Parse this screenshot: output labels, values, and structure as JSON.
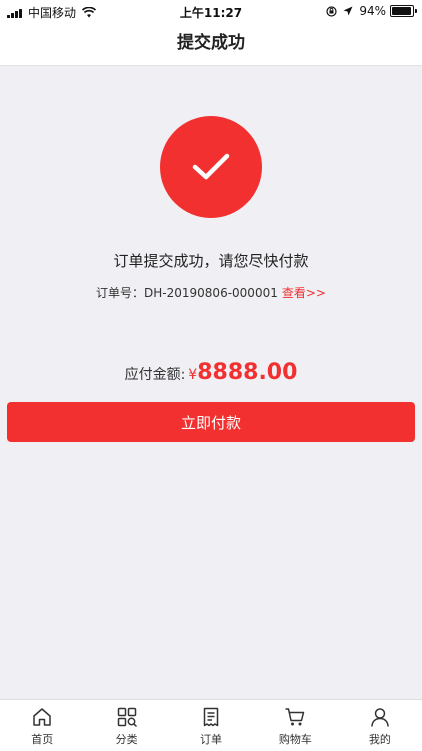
{
  "status_bar": {
    "carrier": "中国移动",
    "time": "上午11:27",
    "battery_text": "94%",
    "battery_level": 0.94
  },
  "nav": {
    "title": "提交成功"
  },
  "result": {
    "message": "订单提交成功，请您尽快付款",
    "order_label": "订单号：",
    "order_number": "DH-20190806-000001",
    "view_link": "查看>>"
  },
  "payment": {
    "amount_label": "应付金额:",
    "currency_symbol": "¥",
    "amount": "8888.00",
    "pay_button": "立即付款"
  },
  "tabs": [
    {
      "label": "首页",
      "icon": "home-icon"
    },
    {
      "label": "分类",
      "icon": "category-icon"
    },
    {
      "label": "订单",
      "icon": "order-icon"
    },
    {
      "label": "购物车",
      "icon": "cart-icon"
    },
    {
      "label": "我的",
      "icon": "user-icon"
    }
  ],
  "colors": {
    "accent": "#f23030",
    "background": "#efeff4"
  }
}
